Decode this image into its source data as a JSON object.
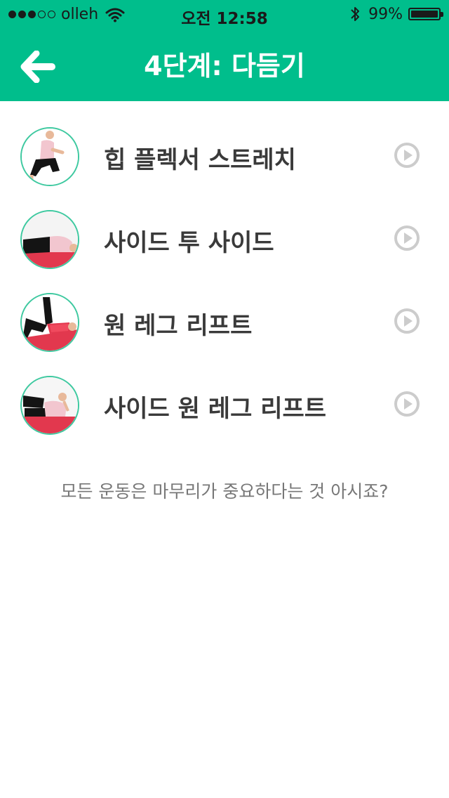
{
  "status_bar": {
    "signal_bars_filled": 3,
    "signal_bars_total": 5,
    "carrier": "olleh",
    "time": "오전 12:58",
    "battery_percent": "99%",
    "battery_level": 0.99
  },
  "nav": {
    "title": "4단계: 다듬기",
    "back_icon": "arrow-left-icon"
  },
  "exercises": [
    {
      "label": "힙 플렉서 스트레치"
    },
    {
      "label": "사이드 투 사이드"
    },
    {
      "label": "원 레그 리프트"
    },
    {
      "label": "사이드 원 레그 리프트"
    }
  ],
  "footer": {
    "text": "모든 운동은 마무리가 중요하다는 것 아시죠?"
  },
  "colors": {
    "accent": "#00BE8C",
    "thumb_border": "#3EC9A0",
    "play_icon": "#CCCCCC",
    "mat": "#E2384E"
  }
}
